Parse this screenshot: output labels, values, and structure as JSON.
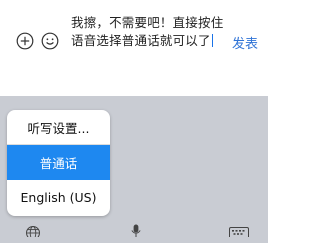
{
  "composer": {
    "message_text": "我擦，不需要吧！直接按住语音选择普通话就可以了",
    "send_label": "发表"
  },
  "keyboard": {
    "language_menu": {
      "items": [
        {
          "label": "听写设置..."
        },
        {
          "label": "普通话",
          "selected": true
        },
        {
          "label": "English (US)"
        }
      ]
    }
  },
  "colors": {
    "accent": "#2f73d6",
    "selected_bg": "#1e88f0",
    "keyboard_bg": "#c9ccd3"
  },
  "icons": [
    "add-circle-icon",
    "emoji-icon",
    "globe-icon",
    "microphone-icon",
    "keyboard-icon"
  ]
}
